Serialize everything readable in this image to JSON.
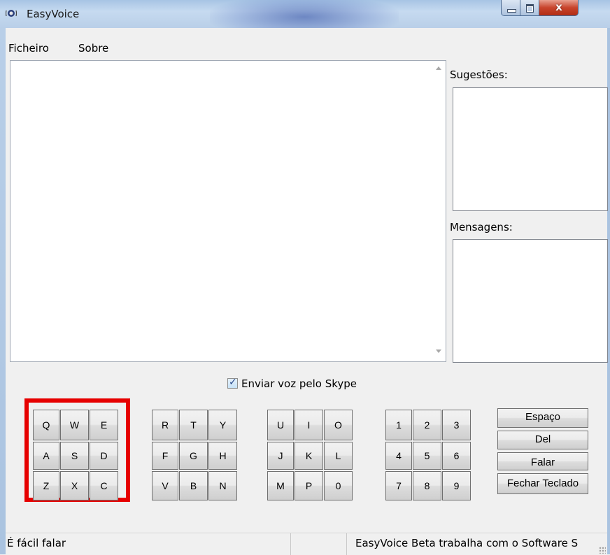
{
  "window": {
    "title": "EasyVoice"
  },
  "menu": {
    "items": [
      "Ficheiro",
      "Sobre"
    ]
  },
  "side": {
    "suggestions_label": "Sugestões:",
    "messages_label": "Mensagens:"
  },
  "checkbox": {
    "label": "Enviar voz pelo Skype",
    "checked": true
  },
  "keypads": [
    {
      "keys": [
        "Q",
        "W",
        "E",
        "A",
        "S",
        "D",
        "Z",
        "X",
        "C"
      ],
      "highlighted": true
    },
    {
      "keys": [
        "R",
        "T",
        "Y",
        "F",
        "G",
        "H",
        "V",
        "B",
        "N"
      ],
      "highlighted": false
    },
    {
      "keys": [
        "U",
        "I",
        "O",
        "J",
        "K",
        "L",
        "M",
        "P",
        "0"
      ],
      "highlighted": false
    },
    {
      "keys": [
        "1",
        "2",
        "3",
        "4",
        "5",
        "6",
        "7",
        "8",
        "9"
      ],
      "highlighted": false
    }
  ],
  "function_keys": [
    "Espaço",
    "Del",
    "Falar",
    "Fechar Teclado"
  ],
  "status": {
    "left": "É fácil falar",
    "middle": "",
    "right": "EasyVoice Beta trabalha com o Software S"
  },
  "colors": {
    "highlight_border": "#e60000",
    "titlebar": "#b9cfe8",
    "close_button": "#c8442c"
  }
}
